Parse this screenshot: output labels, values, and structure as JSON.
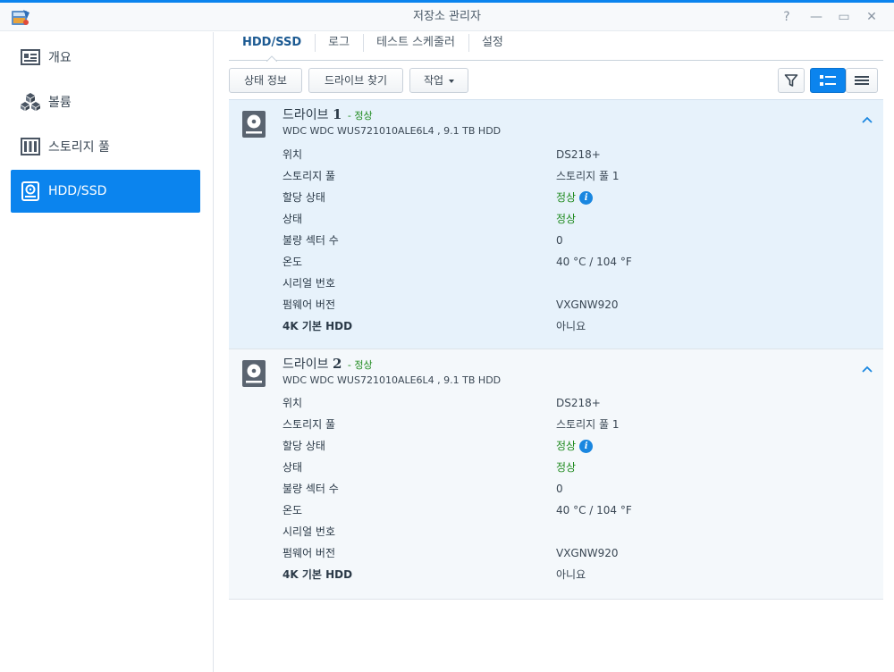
{
  "window": {
    "title": "저장소 관리자",
    "controls": {
      "help": "?",
      "minimize": "—",
      "maximize": "▭",
      "close": "✕"
    }
  },
  "sidebar": {
    "items": [
      {
        "label": "개요",
        "icon": "overview-icon",
        "active": false
      },
      {
        "label": "볼륨",
        "icon": "volume-cubes-icon",
        "active": false
      },
      {
        "label": "스토리지 풀",
        "icon": "storage-pool-icon",
        "active": false
      },
      {
        "label": "HDD/SSD",
        "icon": "hdd-icon",
        "active": true
      }
    ]
  },
  "tabs": [
    {
      "label": "HDD/SSD",
      "active": true
    },
    {
      "label": "로그",
      "active": false
    },
    {
      "label": "테스트 스케줄러",
      "active": false
    },
    {
      "label": "설정",
      "active": false
    }
  ],
  "toolbar": {
    "status_info": "상태 정보",
    "find_drive": "드라이브 찾기",
    "action": "작업",
    "filter_icon": "filter-icon",
    "view_list_icon": "list-view-icon",
    "view_compact_icon": "compact-view-icon"
  },
  "labels": {
    "location": "위치",
    "storage_pool": "스토리지 풀",
    "allocation_status": "할당 상태",
    "status": "상태",
    "bad_sectors": "불량 섹터 수",
    "temperature": "온도",
    "serial": "시리얼 번호",
    "firmware": "펌웨어 버전",
    "native_4k": "4K 기본 HDD"
  },
  "drives": [
    {
      "prefix": "드라이브",
      "number": "1",
      "status": "- 정상",
      "model": "WDC WDC WUS721010ALE6L4 , 9.1 TB HDD",
      "location": "DS218+",
      "storage_pool": "스토리지 풀 1",
      "allocation_status": "정상",
      "status_value": "정상",
      "bad_sectors": "0",
      "temperature": "40 °C / 104 °F",
      "serial": "",
      "firmware": "VXGNW920",
      "native_4k": "아니요"
    },
    {
      "prefix": "드라이브",
      "number": "2",
      "status": "- 정상",
      "model": "WDC WDC WUS721010ALE6L4 , 9.1 TB HDD",
      "location": "DS218+",
      "storage_pool": "스토리지 풀 1",
      "allocation_status": "정상",
      "status_value": "정상",
      "bad_sectors": "0",
      "temperature": "40 °C / 104 °F",
      "serial": "",
      "firmware": "VXGNW920",
      "native_4k": "아니요"
    }
  ],
  "colors": {
    "accent": "#0b84ee",
    "ok_green": "#1e8a1e",
    "selected_row_bg": "#e7f2fb"
  }
}
